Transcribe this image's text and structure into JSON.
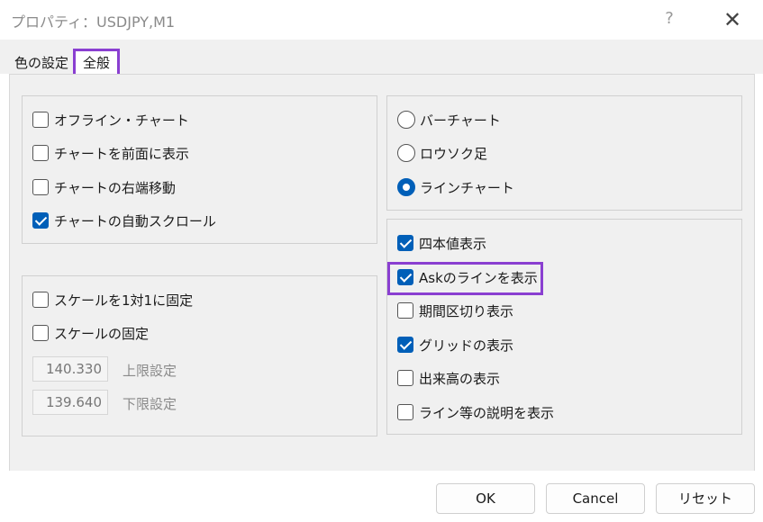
{
  "window": {
    "title": "プロパティ：USDJPY,M1",
    "help_label": "?",
    "close_label": "✕"
  },
  "tabs": [
    {
      "label": "色の設定"
    },
    {
      "label": "全般"
    }
  ],
  "left_group1": [
    {
      "label": "オフライン・チャート",
      "checked": false
    },
    {
      "label": "チャートを前面に表示",
      "checked": false
    },
    {
      "label": "チャートの右端移動",
      "checked": false
    },
    {
      "label": "チャートの自動スクロール",
      "checked": true
    }
  ],
  "left_group2": [
    {
      "label": "スケールを1対1に固定",
      "checked": false
    },
    {
      "label": "スケールの固定",
      "checked": false
    }
  ],
  "scale": {
    "upper_value": "140.330",
    "upper_label": "上限設定",
    "lower_value": "139.640",
    "lower_label": "下限設定"
  },
  "chart_type": [
    {
      "label": "バーチャート",
      "selected": false
    },
    {
      "label": "ロウソク足",
      "selected": false
    },
    {
      "label": "ラインチャート",
      "selected": true
    }
  ],
  "right_group2": [
    {
      "label": "四本値表示",
      "checked": true
    },
    {
      "label": "Askのラインを表示",
      "checked": true
    },
    {
      "label": "期間区切り表示",
      "checked": false
    },
    {
      "label": "グリッドの表示",
      "checked": true
    },
    {
      "label": "出来高の表示",
      "checked": false
    },
    {
      "label": "ライン等の説明を表示",
      "checked": false
    }
  ],
  "buttons": {
    "ok": "OK",
    "cancel": "Cancel",
    "reset": "リセット"
  },
  "colors": {
    "accent": "#005fb8",
    "highlight": "#8a3fd1"
  }
}
